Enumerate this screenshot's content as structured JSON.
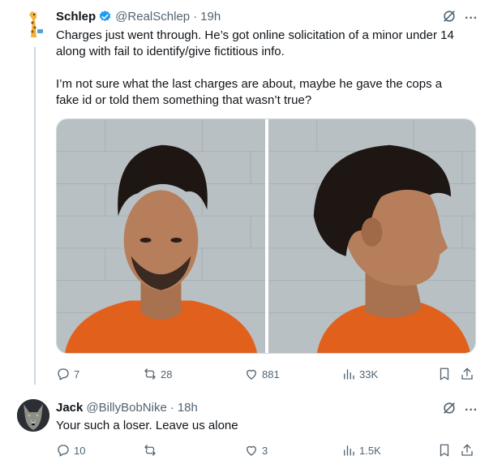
{
  "tweets": [
    {
      "author_name": "Schlep",
      "handle": "@RealSchlep",
      "separator": "·",
      "time": "19h",
      "text_lines": [
        "Charges just went through. He’s got online solicitation of a minor under 14",
        "along with fail to identify/give fictitious info.",
        "",
        "I’m not sure what the last charges are about, maybe he gave the cops a",
        "fake id or told them something that wasn’t true?"
      ],
      "replies": "7",
      "reposts": "28",
      "likes": "881",
      "views": "33K",
      "avatar_icon": "giraffe-avatar",
      "verified_icon": "verified-badge-icon"
    },
    {
      "author_name": "Jack",
      "handle": "@BillyBobNike",
      "separator": "·",
      "time": "18h",
      "text_lines": [
        "Your such a loser. Leave us alone"
      ],
      "replies": "10",
      "reposts": "",
      "likes": "3",
      "views": "1.5K",
      "avatar_icon": "wolf-avatar"
    }
  ],
  "colors": {
    "text": "#0f1419",
    "secondary": "#536471",
    "verified": "#1d9bf0",
    "border": "#cfd9de",
    "mugshot_wall": "#b8c0c4",
    "jumpsuit": "#e0601c"
  }
}
